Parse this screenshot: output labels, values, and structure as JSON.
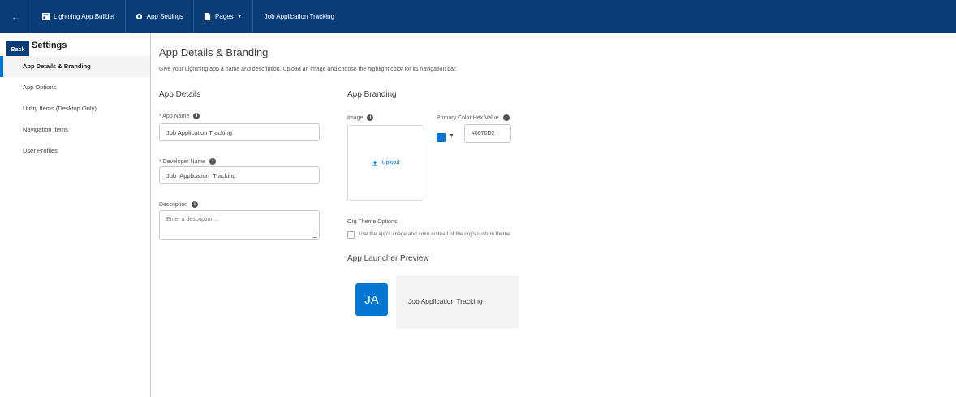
{
  "topbar": {
    "back_glyph": "←",
    "builder_label": "Lightning App Builder",
    "settings_label": "App Settings",
    "pages_label": "Pages",
    "app_title": "Job Application Tracking",
    "bg_color": "#0a3d78"
  },
  "sidebar": {
    "badge": "Back",
    "title": "Settings",
    "items": [
      {
        "label": "App Details & Branding",
        "active": true
      },
      {
        "label": "App Options"
      },
      {
        "label": "Utility Items (Desktop Only)"
      },
      {
        "label": "Navigation Items"
      },
      {
        "label": "User Profiles"
      }
    ]
  },
  "main": {
    "title": "App Details & Branding",
    "description": "Give your Lightning app a name and description. Upload an image and choose the highlight color for its navigation bar.",
    "details": {
      "heading": "App Details",
      "app_name_label": "* App Name",
      "app_name_value": "Job Application Tracking",
      "developer_name_label": "* Developer Name",
      "developer_name_value": "Job_Application_Tracking",
      "description_label": "Description",
      "description_placeholder": "Enter a description..."
    },
    "branding": {
      "heading": "App Branding",
      "image_label": "Image",
      "upload_label": "Upload",
      "color_label": "Primary Color Hex Value",
      "color_value": "#0070D2",
      "swatch_color": "#0176d3",
      "org_theme_label": "Org Theme Options",
      "org_theme_checkbox": "Use the app's image and color instead of the org's custom theme"
    },
    "preview": {
      "heading": "App Launcher Preview",
      "initials": "JA",
      "app_name": "Job Application Tracking"
    }
  }
}
